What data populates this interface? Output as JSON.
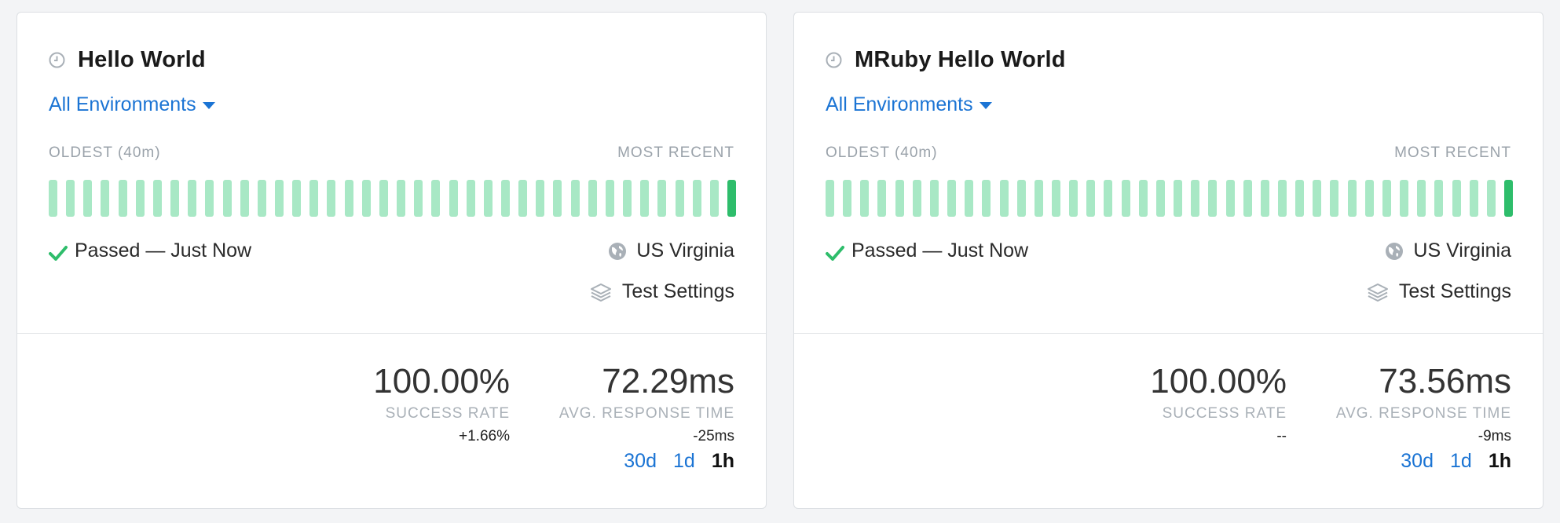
{
  "checks": [
    {
      "title": "Hello World",
      "environment": "All Environments",
      "timeline_oldest": "OLDEST (40m)",
      "timeline_recent": "MOST RECENT",
      "run_bar_count": 40,
      "status": "Passed — Just Now",
      "region": "US Virginia",
      "settings_label": "Test Settings",
      "success_rate": "100.00%",
      "success_rate_label": "SUCCESS RATE",
      "success_rate_delta": "+1.66%",
      "response_time": "72.29ms",
      "response_time_label": "AVG. RESPONSE TIME",
      "response_time_delta": "-25ms",
      "ranges": [
        "30d",
        "1d",
        "1h"
      ],
      "active_range": "1h"
    },
    {
      "title": "MRuby Hello World",
      "environment": "All Environments",
      "timeline_oldest": "OLDEST (40m)",
      "timeline_recent": "MOST RECENT",
      "run_bar_count": 40,
      "status": "Passed — Just Now",
      "region": "US Virginia",
      "settings_label": "Test Settings",
      "success_rate": "100.00%",
      "success_rate_label": "SUCCESS RATE",
      "success_rate_delta": "--",
      "response_time": "73.56ms",
      "response_time_label": "AVG. RESPONSE TIME",
      "response_time_delta": "-9ms",
      "ranges": [
        "30d",
        "1d",
        "1h"
      ],
      "active_range": "1h"
    }
  ],
  "icons": {
    "clock": "clock-icon",
    "caret": "caret-down-icon",
    "check": "check-icon",
    "globe": "globe-icon",
    "layers": "layers-icon"
  },
  "colors": {
    "link": "#1b74d4",
    "bar_passed": "#a8e8c5",
    "bar_latest": "#2ebd6b",
    "check": "#2ebd6b",
    "icon_grey": "#a9b0b7"
  }
}
